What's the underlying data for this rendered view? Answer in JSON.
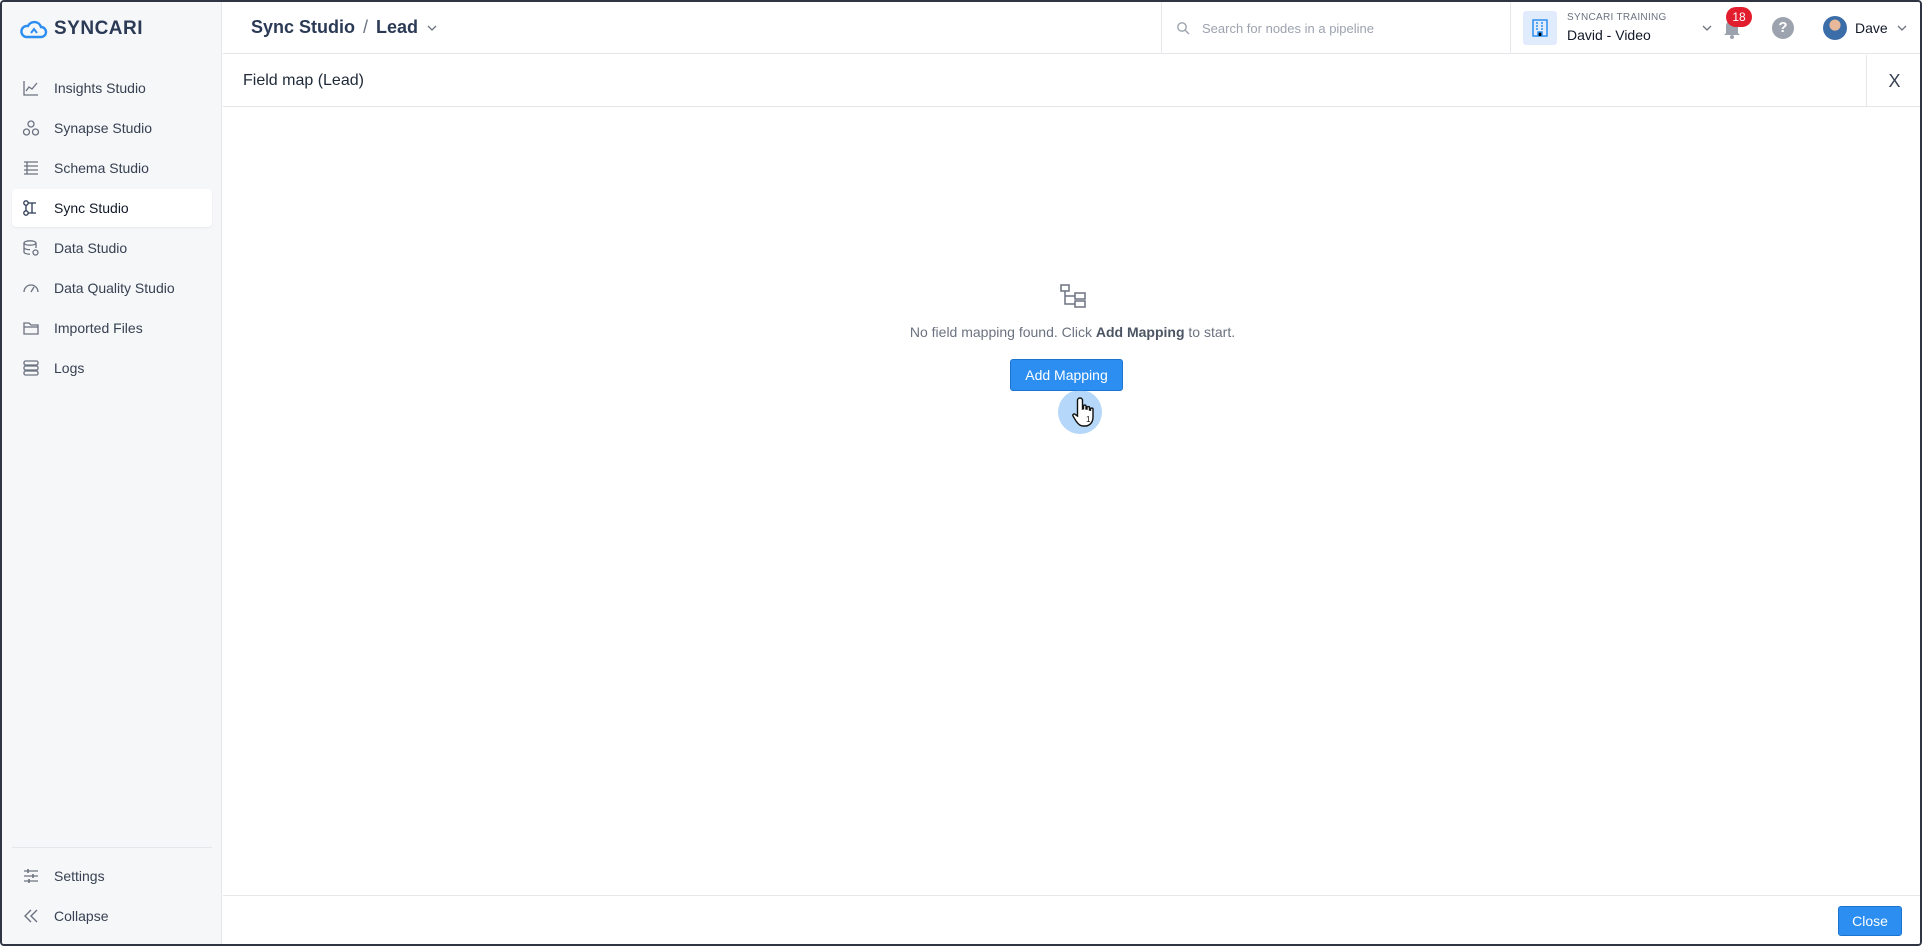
{
  "app": {
    "logo_text": "SYNCARI"
  },
  "sidebar": {
    "items": [
      {
        "label": "Insights Studio",
        "icon": "chart-icon"
      },
      {
        "label": "Synapse Studio",
        "icon": "synapse-icon"
      },
      {
        "label": "Schema Studio",
        "icon": "schema-icon"
      },
      {
        "label": "Sync Studio",
        "icon": "sync-icon",
        "active": true
      },
      {
        "label": "Data Studio",
        "icon": "database-icon"
      },
      {
        "label": "Data Quality Studio",
        "icon": "gauge-icon"
      },
      {
        "label": "Imported Files",
        "icon": "folder-icon"
      },
      {
        "label": "Logs",
        "icon": "logs-icon"
      }
    ],
    "bottom": [
      {
        "label": "Settings",
        "icon": "sliders-icon"
      },
      {
        "label": "Collapse",
        "icon": "double-chevron-left-icon"
      }
    ]
  },
  "header": {
    "breadcrumb": {
      "root": "Sync Studio",
      "separator": "/",
      "current": "Lead"
    },
    "search": {
      "placeholder": "Search for nodes in a pipeline",
      "value": ""
    },
    "workspace": {
      "org": "SYNCARI TRAINING",
      "name": "David - Video"
    },
    "notifications": {
      "count": "18"
    },
    "help_label": "?",
    "user": {
      "name": "Dave"
    }
  },
  "panel": {
    "title": "Field map (Lead)",
    "close_symbol": "X",
    "empty": {
      "message_prefix": "No field mapping found. Click ",
      "message_bold": "Add Mapping",
      "message_suffix": " to start."
    },
    "add_button": "Add Mapping",
    "cursor_badge": "1",
    "footer_close": "Close"
  },
  "colors": {
    "accent": "#2b8ef0",
    "badge": "#e11d2e",
    "brand": "#2b3a55"
  }
}
